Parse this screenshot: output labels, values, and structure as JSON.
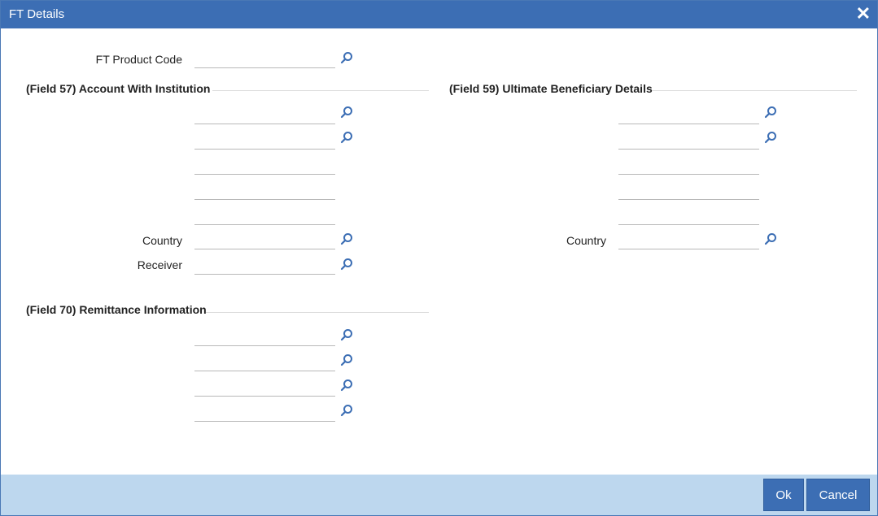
{
  "window": {
    "title": "FT Details",
    "close_glyph": "✕"
  },
  "product": {
    "label": "FT Product Code",
    "value": ""
  },
  "field57": {
    "heading": "(Field 57) Account With Institution",
    "lines": [
      "",
      "",
      "",
      "",
      ""
    ],
    "country_label": "Country",
    "country_value": "",
    "receiver_label": "Receiver",
    "receiver_value": ""
  },
  "field59": {
    "heading": "(Field 59) Ultimate Beneficiary Details",
    "lines": [
      "",
      "",
      "",
      "",
      ""
    ],
    "country_label": "Country",
    "country_value": ""
  },
  "field70": {
    "heading": "(Field 70) Remittance Information",
    "lines": [
      "",
      "",
      "",
      ""
    ]
  },
  "footer": {
    "ok_label": "Ok",
    "cancel_label": "Cancel"
  },
  "colors": {
    "titlebar": "#3c6eb4",
    "footer": "#bdd7ee",
    "accent": "#3c6eb4",
    "lookup_icon": "#3c6eb4"
  },
  "icons": {
    "lookup": "search-icon",
    "close": "close-icon"
  }
}
